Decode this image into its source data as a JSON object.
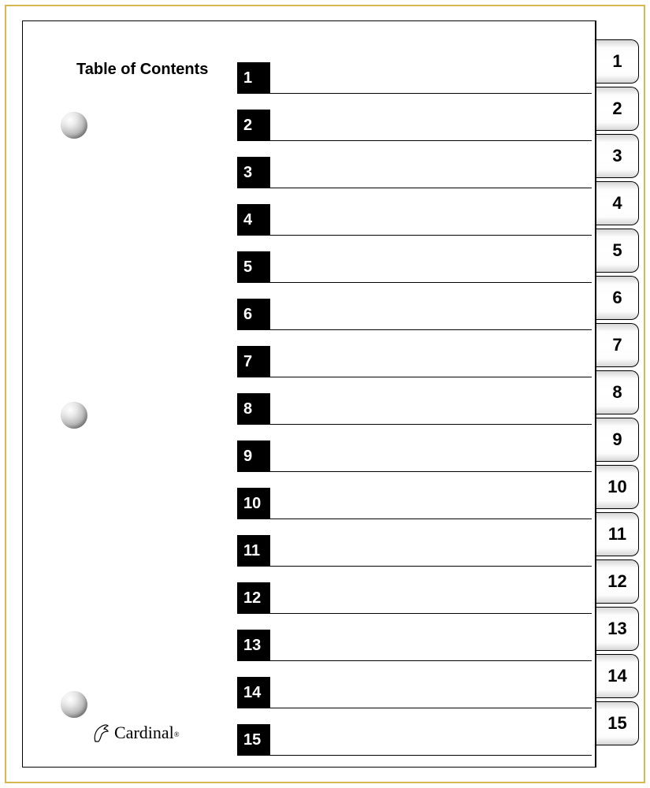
{
  "title": "Table of Contents",
  "brand": "Cardinal",
  "brand_mark": "®",
  "toc": {
    "items": [
      {
        "num": "1"
      },
      {
        "num": "2"
      },
      {
        "num": "3"
      },
      {
        "num": "4"
      },
      {
        "num": "5"
      },
      {
        "num": "6"
      },
      {
        "num": "7"
      },
      {
        "num": "8"
      },
      {
        "num": "9"
      },
      {
        "num": "10"
      },
      {
        "num": "11"
      },
      {
        "num": "12"
      },
      {
        "num": "13"
      },
      {
        "num": "14"
      },
      {
        "num": "15"
      }
    ]
  },
  "tabs": [
    {
      "label": "1"
    },
    {
      "label": "2"
    },
    {
      "label": "3"
    },
    {
      "label": "4"
    },
    {
      "label": "5"
    },
    {
      "label": "6"
    },
    {
      "label": "7"
    },
    {
      "label": "8"
    },
    {
      "label": "9"
    },
    {
      "label": "10"
    },
    {
      "label": "11"
    },
    {
      "label": "12"
    },
    {
      "label": "13"
    },
    {
      "label": "14"
    },
    {
      "label": "15"
    }
  ]
}
